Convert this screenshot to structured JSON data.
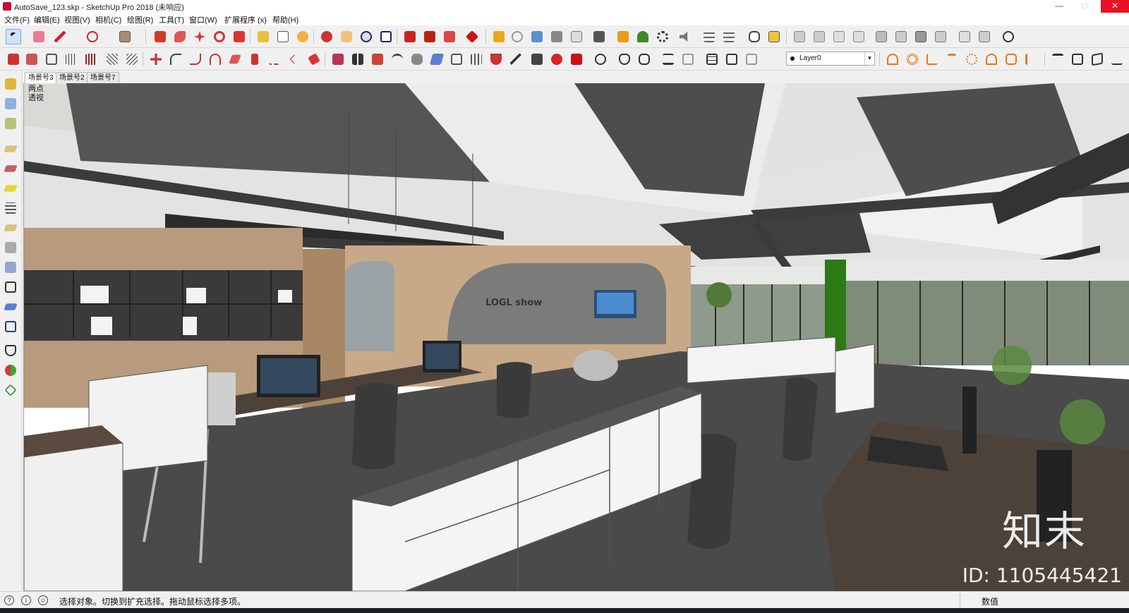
{
  "window": {
    "title": "AutoSave_123.skp - SketchUp Pro 2018 (未响应)",
    "buttons": {
      "minimize": "—",
      "maximize": "□",
      "close": "✕"
    }
  },
  "menu": [
    "文件(F)",
    "编辑(E)",
    "视图(V)",
    "相机(C)",
    "绘图(R)",
    "工具(T)",
    "窗口(W)",
    "扩展程序 (x)",
    "帮助(H)"
  ],
  "toolbar": {
    "layer_value": "Layer0"
  },
  "scene_tabs": [
    "场景号3",
    "场景号2",
    "场景号7"
  ],
  "viewport": {
    "view_label": "两点透视",
    "scene_text": "LOGL show",
    "brand_mark": "知末",
    "id_mark": "ID: 1105445421"
  },
  "status": {
    "hint": "选择对象。切换到扩充选择。拖动鼠标选择多项。",
    "measurement_label": "数值"
  },
  "colors": {
    "ui_bg": "#f0f0f0",
    "accent_red": "#c8102e",
    "close_red": "#e81123",
    "wood": "#b89a7c",
    "green_column": "#2c7a16",
    "floor_dark": "#4a4a4a"
  }
}
